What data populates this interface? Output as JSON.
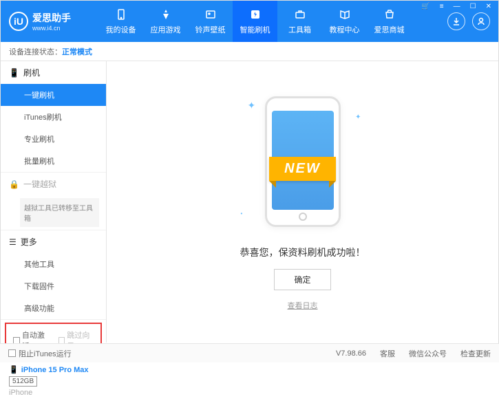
{
  "app": {
    "title": "爱思助手",
    "url": "www.i4.cn"
  },
  "nav": {
    "items": [
      {
        "label": "我的设备"
      },
      {
        "label": "应用游戏"
      },
      {
        "label": "铃声壁纸"
      },
      {
        "label": "智能刷机"
      },
      {
        "label": "工具箱"
      },
      {
        "label": "教程中心"
      },
      {
        "label": "爱思商城"
      }
    ]
  },
  "status": {
    "prefix": "设备连接状态：",
    "mode": "正常模式"
  },
  "sidebar": {
    "flash": {
      "header": "刷机",
      "items": [
        "一键刷机",
        "iTunes刷机",
        "专业刷机",
        "批量刷机"
      ]
    },
    "jailbreak": {
      "header": "一键越狱",
      "note": "越狱工具已转移至工具箱"
    },
    "more": {
      "header": "更多",
      "items": [
        "其他工具",
        "下载固件",
        "高级功能"
      ]
    },
    "checks": {
      "auto_activate": "自动激活",
      "skip_guide": "跳过向导"
    },
    "device": {
      "name": "iPhone 15 Pro Max",
      "storage": "512GB",
      "type": "iPhone"
    }
  },
  "content": {
    "ribbon": "NEW",
    "success": "恭喜您，保资料刷机成功啦！",
    "ok": "确定",
    "view_log": "查看日志"
  },
  "footer": {
    "block_itunes": "阻止iTunes运行",
    "version": "V7.98.66",
    "links": [
      "客服",
      "微信公众号",
      "检查更新"
    ]
  }
}
